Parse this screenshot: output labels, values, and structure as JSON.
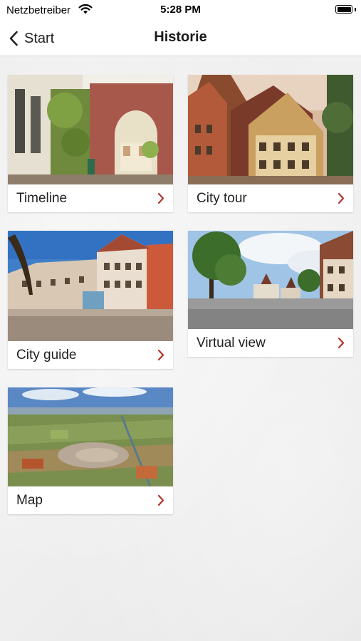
{
  "status_bar": {
    "carrier": "Netzbetreiber",
    "time": "5:28 PM"
  },
  "nav": {
    "back_label": "Start",
    "title": "Historie"
  },
  "tiles": [
    {
      "label": "Timeline",
      "image": "old-town-gate-photo"
    },
    {
      "label": "City tour",
      "image": "half-timbered-houses-photo"
    },
    {
      "label": "City guide",
      "image": "town-square-photo"
    },
    {
      "label": "Virtual view",
      "image": "market-square-photo"
    },
    {
      "label": "Map",
      "image": "aerial-city-photo"
    }
  ],
  "colors": {
    "chevron": "#b0342c",
    "background": "#ececec"
  }
}
